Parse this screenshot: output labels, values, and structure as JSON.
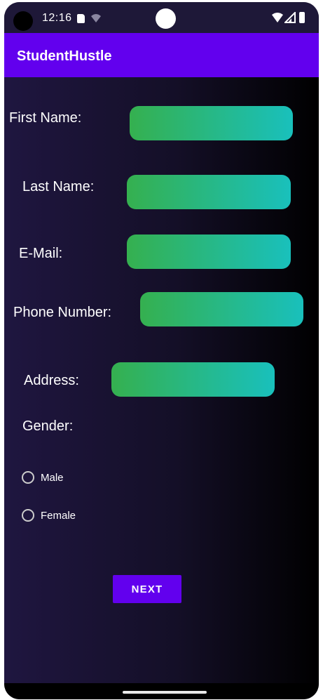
{
  "status_bar": {
    "time": "12:16"
  },
  "app_bar": {
    "title": "StudentHustle"
  },
  "form": {
    "first_name_label": "First Name:",
    "last_name_label": "Last Name:",
    "email_label": "E-Mail:",
    "phone_label": "Phone Number:",
    "address_label": "Address:",
    "gender_label": "Gender:",
    "first_name_value": "",
    "last_name_value": "",
    "email_value": "",
    "phone_value": "",
    "address_value": "",
    "gender_options": [
      "Male",
      "Female"
    ],
    "next_button": "NEXT"
  },
  "colors": {
    "accent": "#6200ee",
    "field_gradient_start": "#35b04f",
    "field_gradient_end": "#19c0bc",
    "background_start": "#1f1640",
    "background_end": "#000000"
  },
  "icons": [
    "sd-card-icon",
    "wifi-icon",
    "signal-icon",
    "battery-icon"
  ]
}
